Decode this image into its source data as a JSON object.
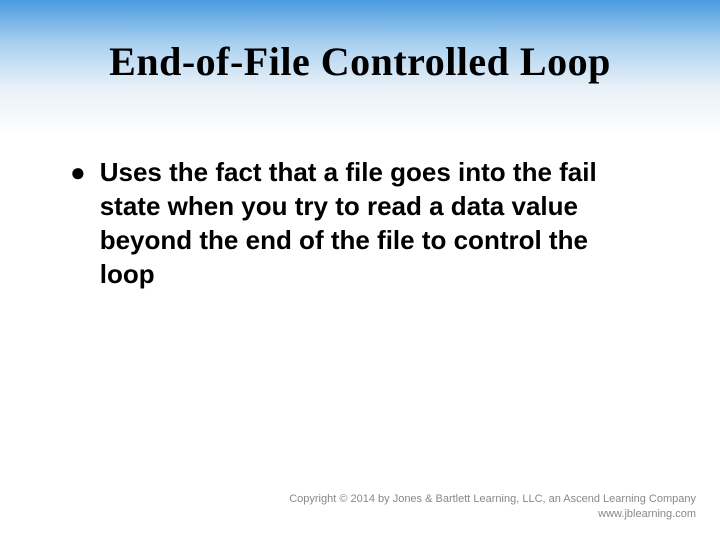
{
  "slide": {
    "title": "End-of-File Controlled Loop",
    "bullets": [
      {
        "text": "Uses the fact that a file goes into the fail state when you try to read a data value beyond the end of the file to control the loop"
      }
    ]
  },
  "footer": {
    "copyright": "Copyright © 2014 by Jones & Bartlett Learning, LLC, an Ascend Learning Company",
    "url": "www.jblearning.com"
  }
}
